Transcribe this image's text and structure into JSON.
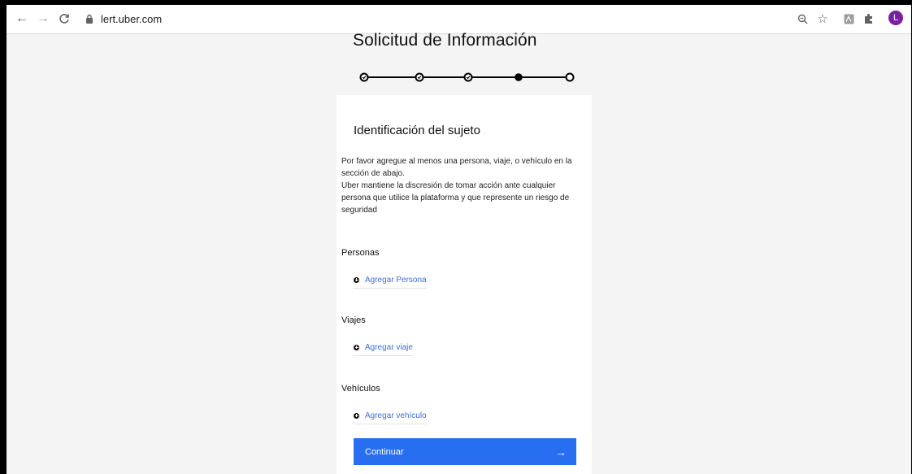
{
  "browser": {
    "url": "lert.uber.com",
    "avatar_initial": "L",
    "icons": [
      "back-icon",
      "forward-icon",
      "reload-icon",
      "lock-icon",
      "zoom-icon",
      "star-icon",
      "pdf-extension-icon",
      "puzzle-extensions-icon"
    ]
  },
  "page": {
    "title": "Solicitud de Información",
    "stepper": {
      "steps_total": 5,
      "current_step": 4
    },
    "section_title": "Identificación del sujeto",
    "description_1": "Por favor agregue al menos una persona, viaje, o vehículo en la sección de abajo.",
    "description_2": "Uber mantiene la discresión de tomar acción ante cualquier persona que utilice la plataforma y que represente un riesgo de seguridad",
    "groups": [
      {
        "label": "Personas",
        "action": "Agregar Persona"
      },
      {
        "label": "Viajes",
        "action": "Agregar viaje"
      },
      {
        "label": "Vehículos",
        "action": "Agregar vehículo"
      }
    ],
    "continue_label": "Continuar"
  },
  "colors": {
    "accent": "#276ef1",
    "link": "#3b6fd8",
    "background": "#f4f4f4",
    "card": "#ffffff",
    "avatar": "#7b1fa2"
  }
}
